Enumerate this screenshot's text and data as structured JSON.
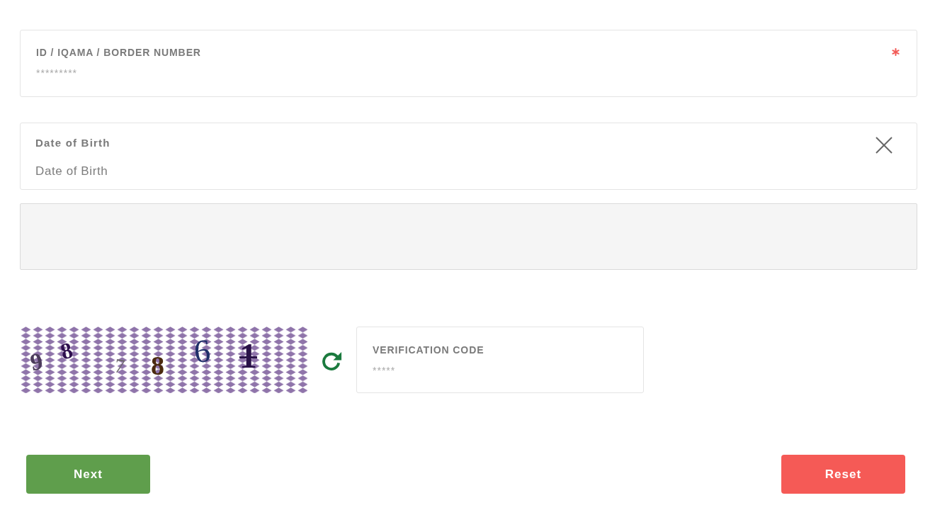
{
  "fields": [
    {
      "kind": "text",
      "label": "ID / IQAMA / BORDER NUMBER",
      "placeholder": "*********",
      "required": true,
      "clearable": false
    },
    {
      "kind": "date",
      "label": "Date of Birth",
      "placeholder": "Date of Birth",
      "required": false,
      "clearable": true
    },
    {
      "kind": "panel"
    }
  ],
  "captcha": {
    "characters": [
      {
        "text": "9",
        "color": "#4b3b5b"
      },
      {
        "text": "8",
        "color": "#2e0f4e"
      },
      {
        "text": "7",
        "color": "#6e6a6e"
      },
      {
        "text": "8",
        "color": "#4b2a0f"
      },
      {
        "text": "6",
        "color": "#1f2f6a"
      },
      {
        "text": "1",
        "color": "#2a1248"
      }
    ]
  },
  "verification": {
    "label": "VERIFICATION CODE",
    "placeholder": "*****"
  },
  "buttons": [
    {
      "label": "Next",
      "kind": "primary"
    },
    {
      "label": "Reset",
      "kind": "danger"
    }
  ]
}
